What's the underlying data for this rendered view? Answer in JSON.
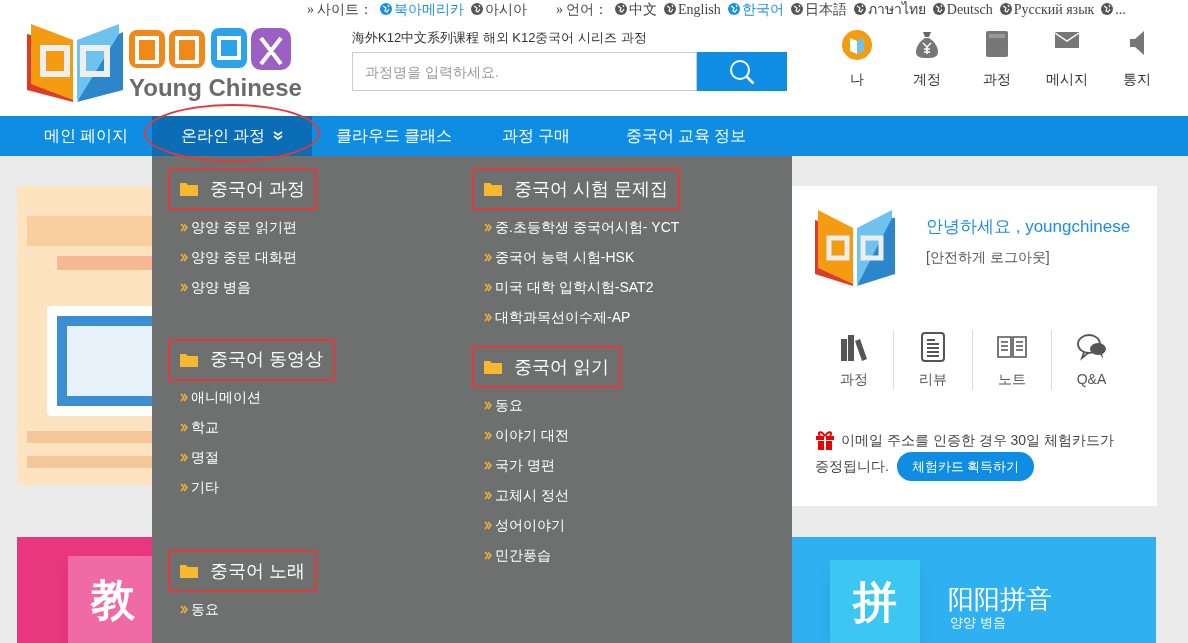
{
  "top_bar": {
    "site_marker": "»",
    "site_label": "사이트：",
    "sites": [
      {
        "label": "북아메리카",
        "selected": true
      },
      {
        "label": "아시아",
        "selected": false
      }
    ],
    "language_marker": "»",
    "language_label": "언어：",
    "languages": [
      {
        "label": "中文",
        "selected": false
      },
      {
        "label": "English",
        "selected": false
      },
      {
        "label": "한국어",
        "selected": true
      },
      {
        "label": "日本語",
        "selected": false
      },
      {
        "label": "ภาษาไทย",
        "selected": false
      },
      {
        "label": "Deutsch",
        "selected": false
      },
      {
        "label": "Русский язык",
        "selected": false
      },
      {
        "label": "...",
        "selected": false
      }
    ]
  },
  "logo": {
    "subtitle": "Young Chinese"
  },
  "tagline": "海外K12中文系列课程 해외 K12중국어 시리즈 과정",
  "search": {
    "placeholder": "과정명을 입력하세요."
  },
  "header_icons": [
    {
      "kind": "avatar",
      "label": "나"
    },
    {
      "kind": "money",
      "label": "계정"
    },
    {
      "kind": "book",
      "label": "과정"
    },
    {
      "kind": "mail",
      "label": "메시지"
    },
    {
      "kind": "speaker",
      "label": "통지"
    }
  ],
  "nav": [
    {
      "label": "메인 페이지",
      "selected": false,
      "circled": false,
      "dropdown": false
    },
    {
      "label": "온라인 과정",
      "selected": true,
      "circled": true,
      "dropdown": true
    },
    {
      "label": "클라우드 클래스",
      "selected": false,
      "circled": false,
      "dropdown": false
    },
    {
      "label": "과정 구매",
      "selected": false,
      "circled": false,
      "dropdown": false
    },
    {
      "label": "중국어 교육 정보",
      "selected": false,
      "circled": false,
      "dropdown": false
    }
  ],
  "dropdown_columns": [
    {
      "groups": [
        {
          "title": "중국어 과정",
          "highlighted": true,
          "items": [
            "양양 중문 읽기편",
            "양양 중문 대화편",
            "양양 병음"
          ]
        },
        {
          "title": "중국어 동영상",
          "highlighted": true,
          "items": [
            "애니메이션",
            "학교",
            "명절",
            "기타"
          ]
        },
        {
          "title": "중국어 노래",
          "highlighted": true,
          "items": [
            "동요"
          ]
        }
      ]
    },
    {
      "groups": [
        {
          "title": "중국어 시험 문제집",
          "highlighted": true,
          "items": [
            "중.초등학생 중국어시험- YCT",
            "중국어 능력 시험-HSK",
            "미국 대학 입학시험-SAT2",
            "대학과목선이수제-AP"
          ]
        },
        {
          "title": "중국어 읽기",
          "highlighted": true,
          "items": [
            "동요",
            "이야기 대전",
            "국가 명편",
            "고체시 정선",
            "성어이야기",
            "민간풍습"
          ]
        }
      ]
    }
  ],
  "user_card": {
    "greeting": "안녕하세요 , youngchinese",
    "logout": "[안전하게 로그아웃]",
    "shortcuts": [
      {
        "kind": "books",
        "label": "과정"
      },
      {
        "kind": "document",
        "label": "리뷰"
      },
      {
        "kind": "open-book",
        "label": "노트"
      },
      {
        "kind": "chat",
        "label": "Q&A"
      }
    ],
    "notice_lines": [
      "이메일 주소를 인증한 경우 30일 체험카드가",
      "증정됩니다."
    ],
    "button": "체험카드 획득하기"
  },
  "course_cards": [
    {
      "tile_char": "教",
      "color": "#e8377f"
    },
    {
      "tile_char": "拼",
      "title": "阳阳拼音",
      "subtitle": "양양 병음",
      "color": "#2fb0f0"
    }
  ]
}
